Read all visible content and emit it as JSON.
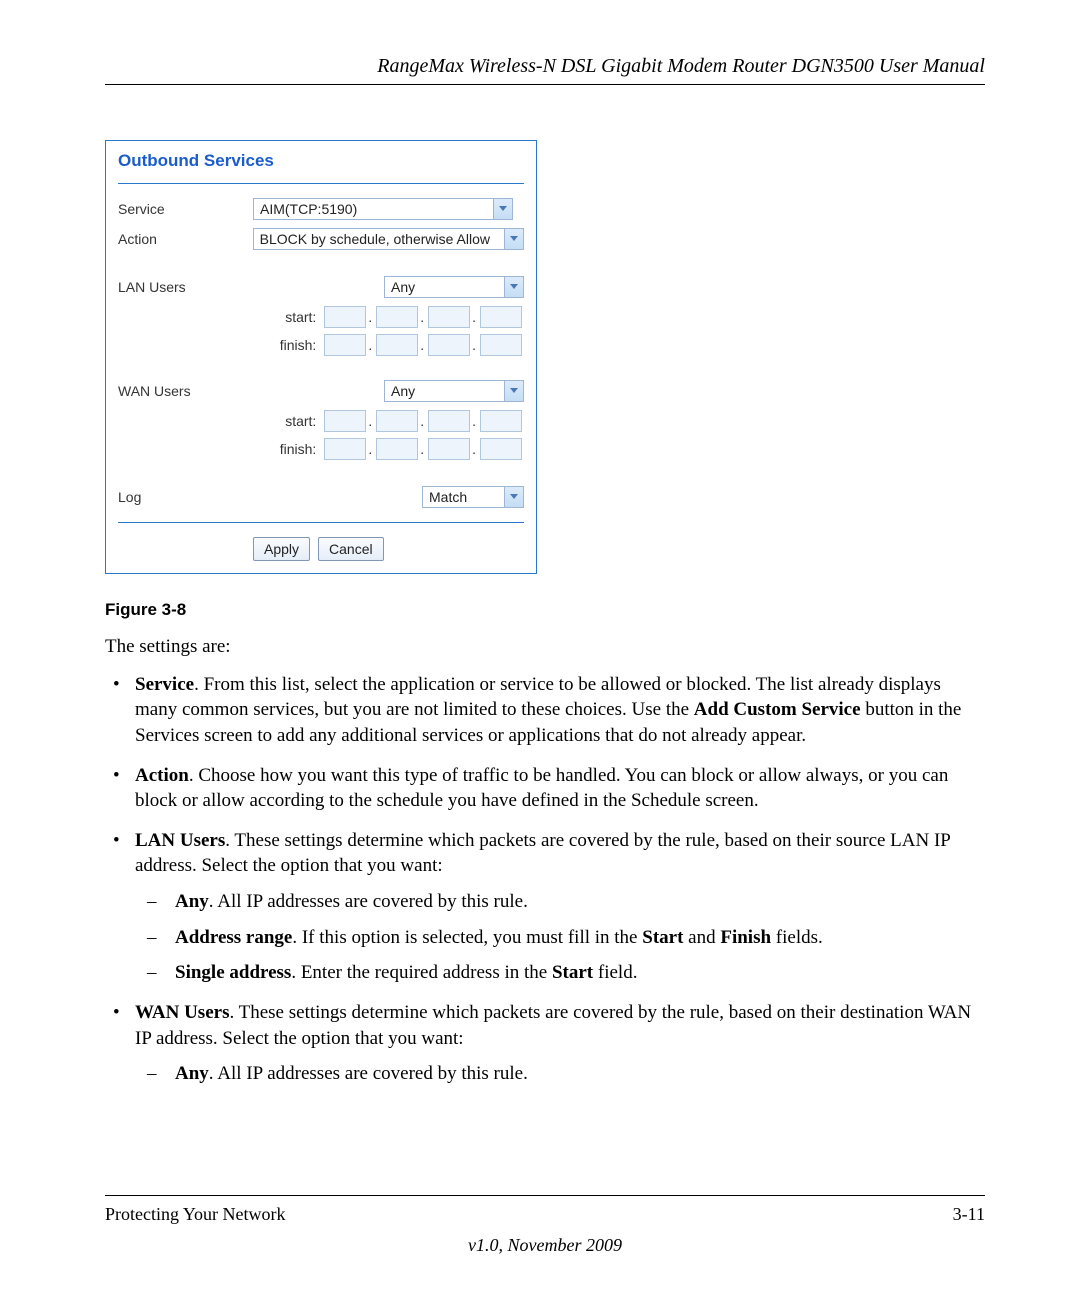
{
  "header": {
    "title": "RangeMax Wireless-N DSL Gigabit Modem Router DGN3500 User Manual"
  },
  "figure": {
    "caption": "Figure 3-8",
    "panel_title": "Outbound Services",
    "labels": {
      "service": "Service",
      "action": "Action",
      "lan_users": "LAN Users",
      "wan_users": "WAN Users",
      "log": "Log",
      "start": "start:",
      "finish": "finish:"
    },
    "values": {
      "service": "AIM(TCP:5190)",
      "action": "BLOCK by schedule, otherwise Allow",
      "lan_users": "Any",
      "wan_users": "Any",
      "log": "Match"
    },
    "buttons": {
      "apply": "Apply",
      "cancel": "Cancel"
    }
  },
  "body": {
    "intro": "The settings are:",
    "service_bold": "Service",
    "service_text": ". From this list, select the application or service to be allowed or blocked. The list already displays many common services, but you are not limited to these choices. Use the ",
    "add_custom_bold": "Add Custom Service",
    "service_text2": " button in the Services screen to add any additional services or applications that do not already appear.",
    "action_bold": "Action",
    "action_text": ". Choose how you want this type of traffic to be handled. You can block or allow always, or you can block or allow according to the schedule you have defined in the Schedule screen.",
    "lan_bold": "LAN Users",
    "lan_text": ". These settings determine which packets are covered by the rule, based on their source LAN IP address. Select the option that you want:",
    "any_bold": "Any",
    "any_text": ". All IP addresses are covered by this rule.",
    "range_bold": "Address range",
    "range_text1": ". If this option is selected, you must fill in the ",
    "start_bold": "Start",
    "range_text2": " and ",
    "finish_bold": "Finish",
    "range_text3": " fields.",
    "single_bold": "Single address",
    "single_text1": ". Enter the required address in the ",
    "single_text2": " field.",
    "wan_bold": "WAN Users",
    "wan_text": ". These settings determine which packets are covered by the rule, based on their destination WAN IP address. Select the option that you want:"
  },
  "footer": {
    "section": "Protecting Your Network",
    "page": "3-11",
    "version": "v1.0, November 2009"
  }
}
